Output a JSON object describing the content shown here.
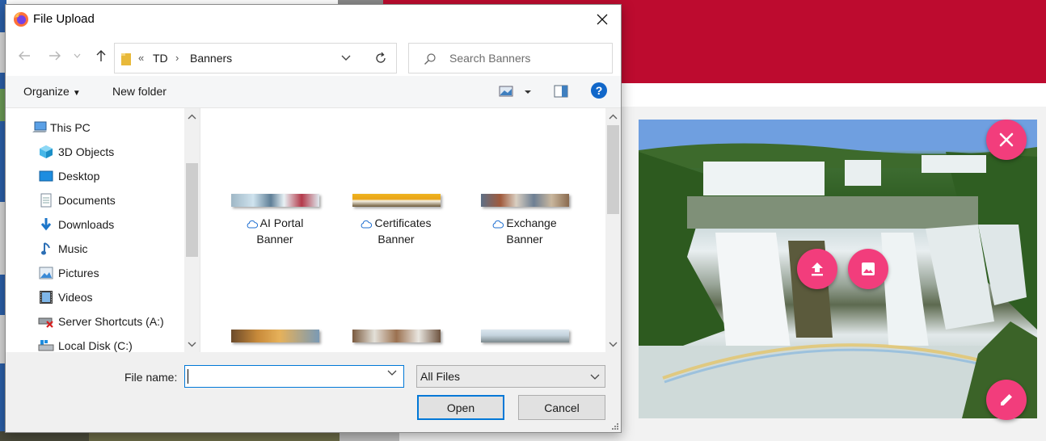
{
  "dialog": {
    "title": "File Upload",
    "address": {
      "crumbs": [
        "TD",
        "Banners"
      ],
      "overflow_marker": "«"
    },
    "search_placeholder": "Search Banners",
    "toolbar": {
      "organize": "Organize",
      "new_folder": "New folder"
    },
    "nav_items": [
      {
        "label": "This PC",
        "icon": "computer-icon"
      },
      {
        "label": "3D Objects",
        "icon": "cube-icon"
      },
      {
        "label": "Desktop",
        "icon": "desktop-icon"
      },
      {
        "label": "Documents",
        "icon": "document-icon"
      },
      {
        "label": "Downloads",
        "icon": "download-icon"
      },
      {
        "label": "Music",
        "icon": "music-icon"
      },
      {
        "label": "Pictures",
        "icon": "picture-icon"
      },
      {
        "label": "Videos",
        "icon": "video-icon"
      },
      {
        "label": "Server Shortcuts (A:)",
        "icon": "network-drive-icon"
      },
      {
        "label": "Local Disk (C:)",
        "icon": "disk-icon"
      }
    ],
    "files": [
      {
        "line1": "AI Portal",
        "line2": "Banner"
      },
      {
        "line1": "Certificates",
        "line2": "Banner"
      },
      {
        "line1": "Exchange",
        "line2": "Banner"
      }
    ],
    "file_name_label": "File name:",
    "file_name_value": "",
    "file_type": "All Files",
    "open_label": "Open",
    "cancel_label": "Cancel"
  },
  "colors": {
    "header_red": "#bd0b2f",
    "fab_pink": "#f23d7c",
    "accent_blue": "#0078d7"
  }
}
